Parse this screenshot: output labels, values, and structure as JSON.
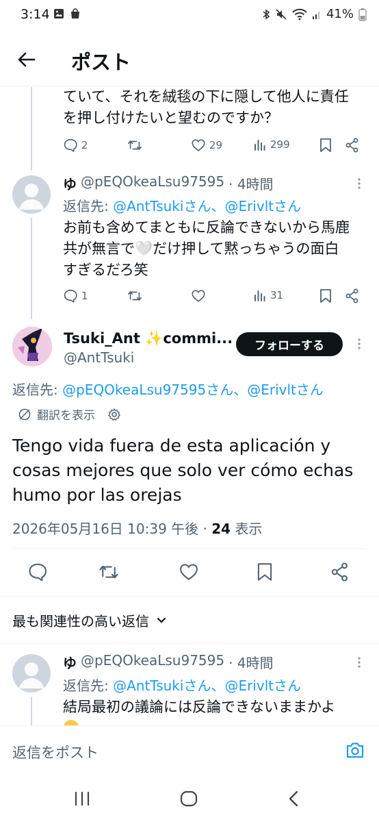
{
  "status_bar": {
    "time": "3:14",
    "battery": "41%"
  },
  "header": {
    "title": "ポスト"
  },
  "previous_post": {
    "text_line1": "ていて、それを絨毯の下に隠して他人に責任",
    "text_line2": "を押し付けたいと望むのですか？",
    "replies": "2",
    "likes": "29",
    "views": "299"
  },
  "reply1": {
    "display_name": "ゆ",
    "handle": "@pEQOkeaLsu97595",
    "time": "· 4時間",
    "replying_to_label": "返信先:",
    "replying_to_users": "@AntTsukiさん、@Erivltさん",
    "text_line1": "お前も含めてまともに反論できないから馬鹿",
    "text_line2": "共が無言で🤍だけ押して黙っちゃうの面白",
    "text_line3": "すぎるだろ笑",
    "replies": "1",
    "views": "31"
  },
  "main_post": {
    "display_name": "Tsuki_Ant ✨commi...",
    "handle": "@AntTsuki",
    "follow_label": "フォローする",
    "replying_to_label": "返信先:",
    "replying_to_users": "@pEQOkeaLsu97595さん、@Erivltさん",
    "translate_label": "翻訳を表示",
    "text_line1": "Tengo vida fuera de esta aplicación y",
    "text_line2": "cosas mejores que solo ver cómo echas",
    "text_line3": "humo por las orejas",
    "timestamp": "2026年05月16日 10:39 午後",
    "view_count": "24",
    "view_label": "表示"
  },
  "sort": {
    "label": "最も関連性の高い返信"
  },
  "reply2": {
    "display_name": "ゆ",
    "handle": "@pEQOkeaLsu97595",
    "time": "· 4時間",
    "replying_to_label": "返信先:",
    "replying_to_users": "@AntTsukiさん、@Erivltさん",
    "text_line1": "結局最初の議論には反論できないままかよ"
  },
  "reply_bar": {
    "placeholder": "返信をポスト"
  },
  "colors": {
    "accent": "#1d9bf0",
    "text": "#0f1419",
    "muted": "#536471",
    "divider": "#eff3f4"
  }
}
